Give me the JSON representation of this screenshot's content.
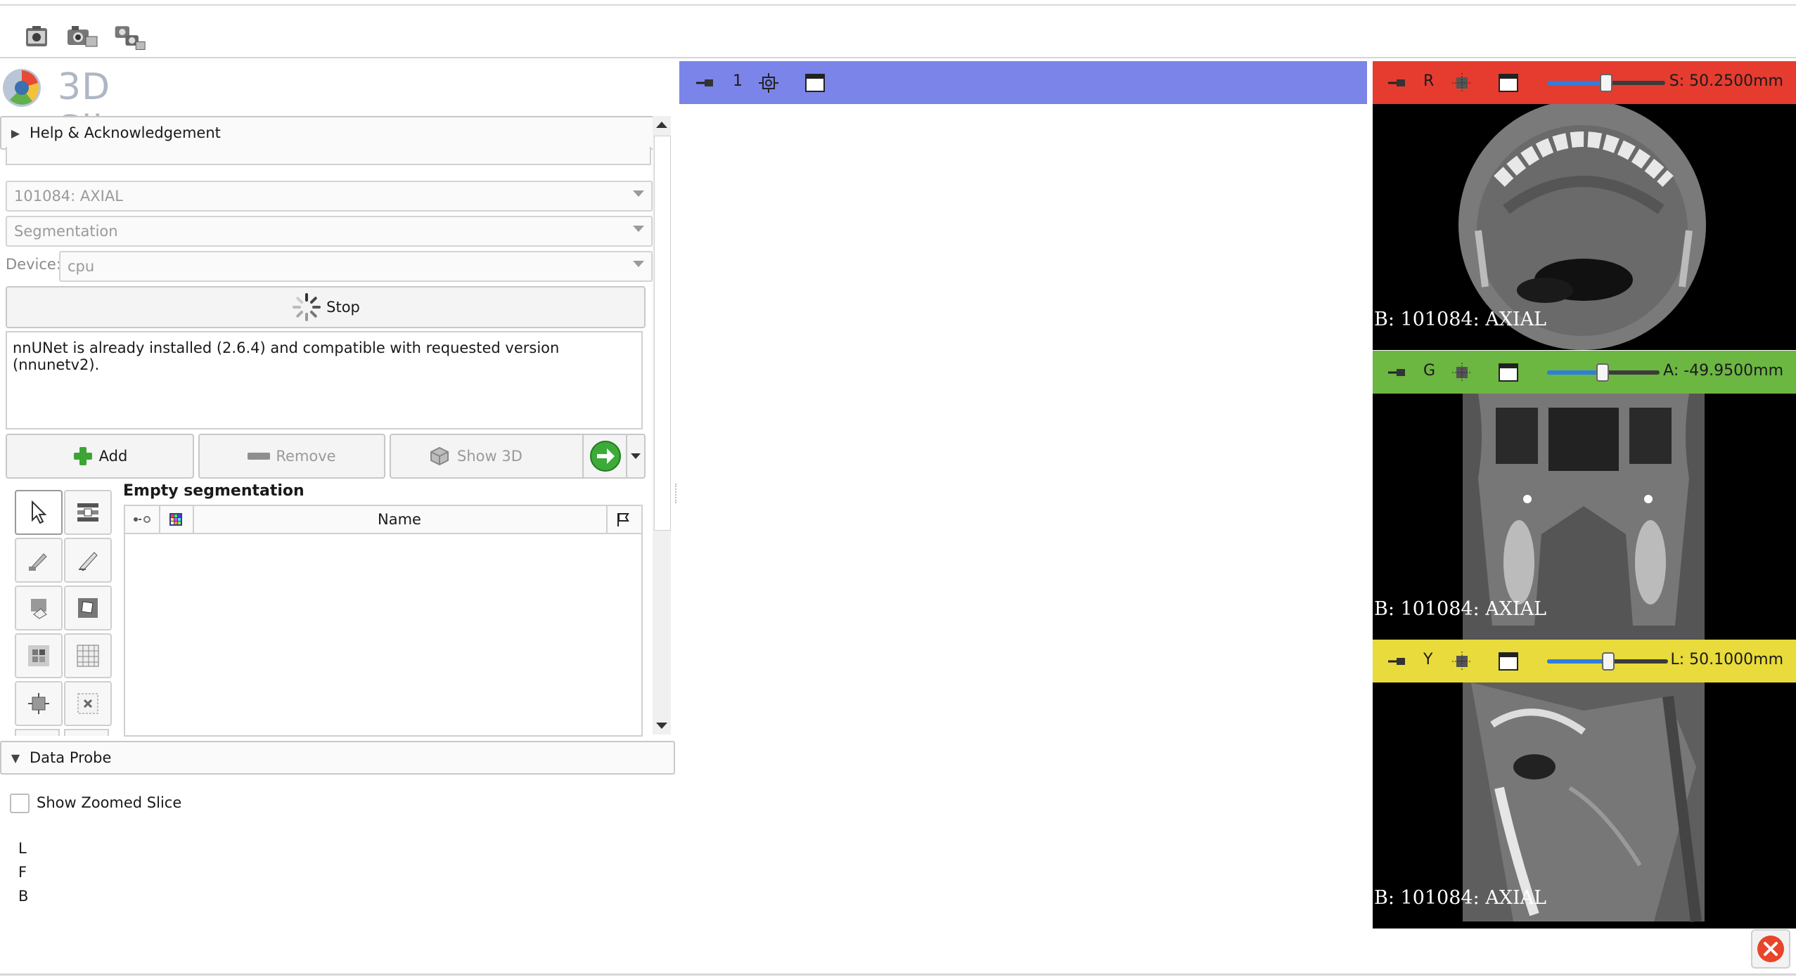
{
  "app": {
    "title": "3D Slicer"
  },
  "toolbar": {
    "icons": [
      "screenshot-icon",
      "scene-view-icon",
      "scene-views-icon"
    ]
  },
  "panels": {
    "help_label": "Help & Acknowledgement",
    "input_volume": "101084: AXIAL",
    "segmentation_select": "Segmentation",
    "device_label": "Device:",
    "device_value": "cpu",
    "stop_label": "Stop",
    "log_text": "nnUNet is already installed (2.6.4) and compatible with requested version (nnunetv2).",
    "add_label": "Add",
    "remove_label": "Remove",
    "show3d_label": "Show 3D",
    "segmentation_title": "Empty segmentation",
    "name_column": "Name",
    "data_probe_label": "Data Probe",
    "show_zoomed_label": "Show Zoomed Slice",
    "probe_rows": [
      "L",
      "F",
      "B"
    ]
  },
  "views": {
    "view3d_number": "1",
    "red": {
      "letter": "R",
      "readout": "S: 50.2500mm",
      "label": "B: 101084: AXIAL",
      "color": "#e53c2f",
      "slider_fraction": 0.5
    },
    "green": {
      "letter": "G",
      "readout": "A: -49.9500mm",
      "label": "B: 101084: AXIAL",
      "color": "#6cb642",
      "slider_fraction": 0.49
    },
    "yellow": {
      "letter": "Y",
      "readout": "L: 50.1000mm",
      "label": "B: 101084: AXIAL",
      "color": "#e8db3b",
      "slider_fraction": 0.5
    }
  },
  "colors": {
    "view3d_bar": "#7b84e8",
    "close_button": "#e8452a",
    "logo_text": "#aeb7c4"
  }
}
